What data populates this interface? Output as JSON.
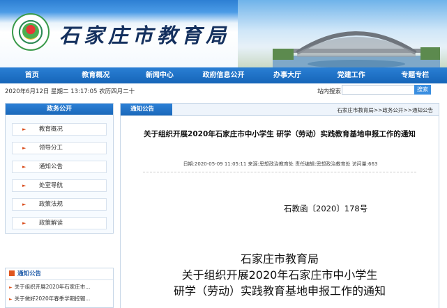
{
  "header": {
    "site_title": "石家庄市教育局"
  },
  "nav": {
    "items": [
      "首页",
      "教育概况",
      "新闻中心",
      "政府信息公开",
      "办事大厅",
      "党建工作",
      "专题专栏"
    ]
  },
  "datebar": {
    "date_text": "2020年6月12日 星期二 13:17:05 农历四月二十",
    "search_label": "站内搜索:",
    "search_button": "搜索"
  },
  "sidebar": {
    "title": "政务公开",
    "items": [
      "教育概况",
      "领导分工",
      "通知公告",
      "处室导航",
      "政策法规",
      "政策解读"
    ]
  },
  "notice": {
    "title": "通知公告",
    "items": [
      "关于组织开展2020年石家庄市...",
      "关于做好2020年春季学期控辍..."
    ]
  },
  "main": {
    "tab": "通知公告",
    "breadcrumb": "石家庄市教育局>>政务公开>>通知公告",
    "title": "关于组织开展2020年石家庄市中小学生 研学（劳动）实践教育基地申报工作的通知",
    "meta": "日期:2020-05-09 11:05:11   来源:思想政治教育处   责任编辑:思想政治教育处   访问量:663",
    "doc_number": "石教函〔2020〕178号",
    "doc_lines": [
      "石家庄市教育局",
      "关于组织开展2020年石家庄市中小学生",
      "研学（劳动）实践教育基地申报工作的通知"
    ]
  },
  "colors": {
    "nav_blue": "#1a6fc4",
    "accent_orange": "#e0561f",
    "title_navy": "#14305e"
  }
}
